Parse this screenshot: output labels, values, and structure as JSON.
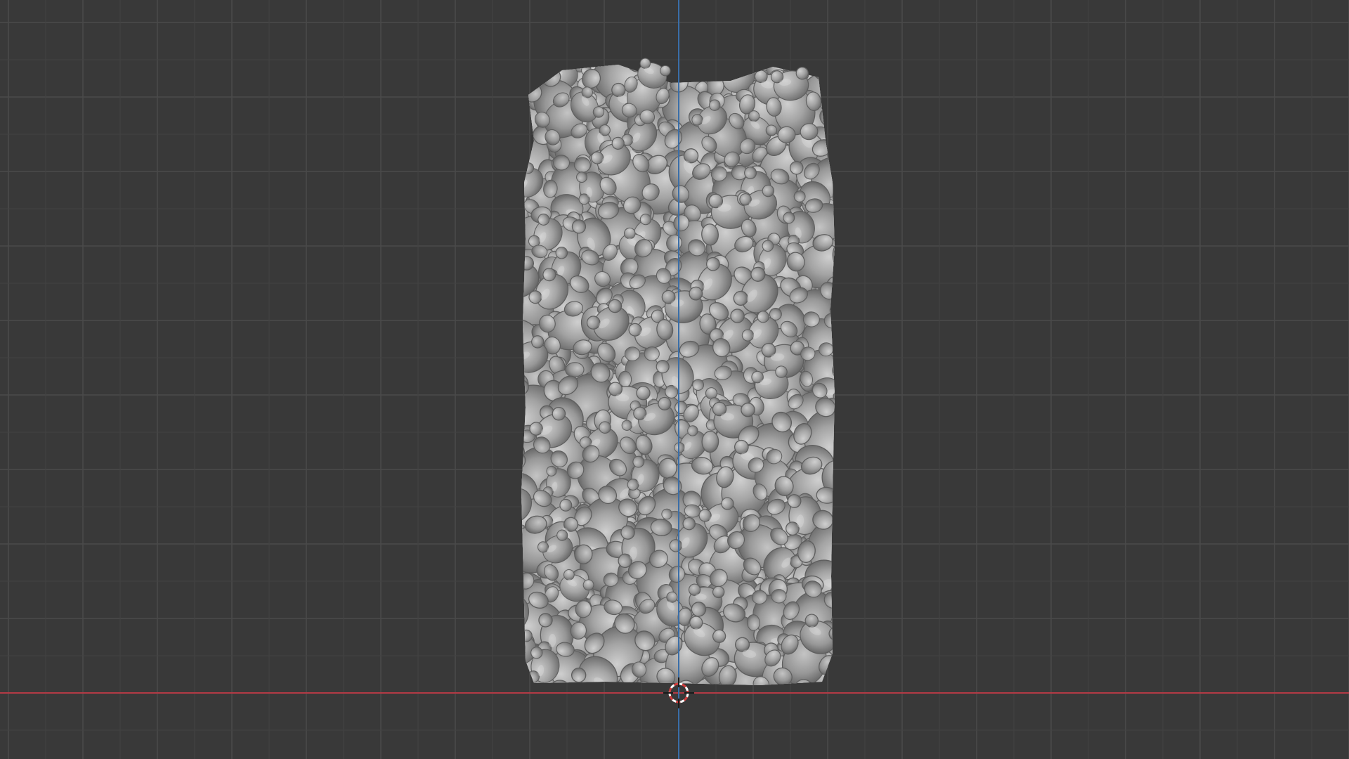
{
  "app": {
    "view": "3d-viewport",
    "projection": "orthographic-front"
  },
  "scene": {
    "object": "gummy-bear-pile",
    "object_shape": "cylinder-fill",
    "shading": "solid"
  },
  "colors": {
    "background": "#393939",
    "grid_minor": "#424242",
    "grid_major": "#4a4a4a",
    "axis_x": "#b33a45",
    "axis_z": "#3a6ea8",
    "bear_base": "#9c9c9c",
    "bear_light": "#c8c8c8",
    "bear_shadow": "#6a6a6a",
    "cursor_red": "#d23c3c",
    "cursor_white": "#ffffff"
  },
  "icons": {
    "cursor": "3d-cursor-icon"
  }
}
